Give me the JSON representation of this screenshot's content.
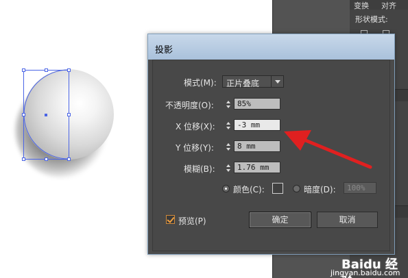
{
  "panel": {
    "tabs": [
      "变换",
      "对齐"
    ],
    "shape_mode_label": "形状模式:"
  },
  "dialog": {
    "title": "投影",
    "mode": {
      "label": "模式(M):",
      "value": "正片叠底"
    },
    "opacity": {
      "label": "不透明度(O):",
      "value": "85%"
    },
    "x_offset": {
      "label": "X 位移(X):",
      "value": "-3 mm"
    },
    "y_offset": {
      "label": "Y 位移(Y):",
      "value": "8 mm"
    },
    "blur": {
      "label": "模糊(B):",
      "value": "1.76 mm"
    },
    "color_radio": {
      "label": "颜色(C):",
      "selected": true
    },
    "darkness_radio": {
      "label": "暗度(D):",
      "value": "100%",
      "selected": false
    },
    "preview": {
      "label": "预览(P)",
      "checked": true
    },
    "ok_label": "确定",
    "cancel_label": "取消"
  },
  "annotation": {
    "arrow_color": "#e02020"
  },
  "watermark": {
    "logo": "Baidu 经验",
    "url": "jingyan.baidu.com"
  },
  "colors": {
    "selection": "#4a64e6",
    "dialog_bg": "#484848",
    "titlebar": "#b8cce2"
  }
}
